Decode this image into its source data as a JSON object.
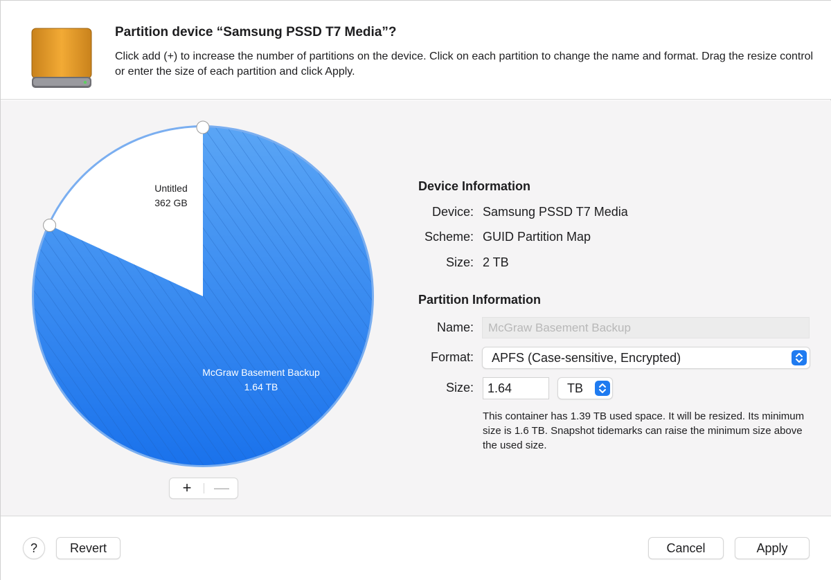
{
  "header": {
    "title": "Partition device “Samsung PSSD T7 Media”?",
    "description": "Click add (+) to increase the number of partitions on the device. Click on each partition to change the name and format. Drag the resize control or enter the size of each partition and click Apply.",
    "icon": "external-drive-icon"
  },
  "partition_map": {
    "partitions": [
      {
        "name": "Untitled",
        "size": "362 GB",
        "fraction": 0.181,
        "color": "#ffffff"
      },
      {
        "name": "McGraw Basement Backup",
        "size": "1.64 TB",
        "fraction": 0.819,
        "color": "#2f86f0"
      }
    ],
    "add_label": "+",
    "remove_label": "—"
  },
  "device_info": {
    "heading": "Device Information",
    "device_label": "Device:",
    "device_value": "Samsung PSSD T7 Media",
    "scheme_label": "Scheme:",
    "scheme_value": "GUID Partition Map",
    "size_label": "Size:",
    "size_value": "2 TB"
  },
  "partition_info": {
    "heading": "Partition Information",
    "name_label": "Name:",
    "name_placeholder": "McGraw Basement Backup",
    "format_label": "Format:",
    "format_value": "APFS (Case-sensitive, Encrypted)",
    "size_label": "Size:",
    "size_value": "1.64",
    "unit_value": "TB",
    "note": "This container has 1.39 TB used space. It will be resized. Its minimum size is 1.6 TB. Snapshot tidemarks can raise the minimum size above the used size."
  },
  "footer": {
    "help_label": "?",
    "revert_label": "Revert",
    "cancel_label": "Cancel",
    "apply_label": "Apply"
  },
  "colors": {
    "accent": "#1f7bf0",
    "partition_blue": "#2f86f0",
    "drive_orange": "#f0a531"
  }
}
